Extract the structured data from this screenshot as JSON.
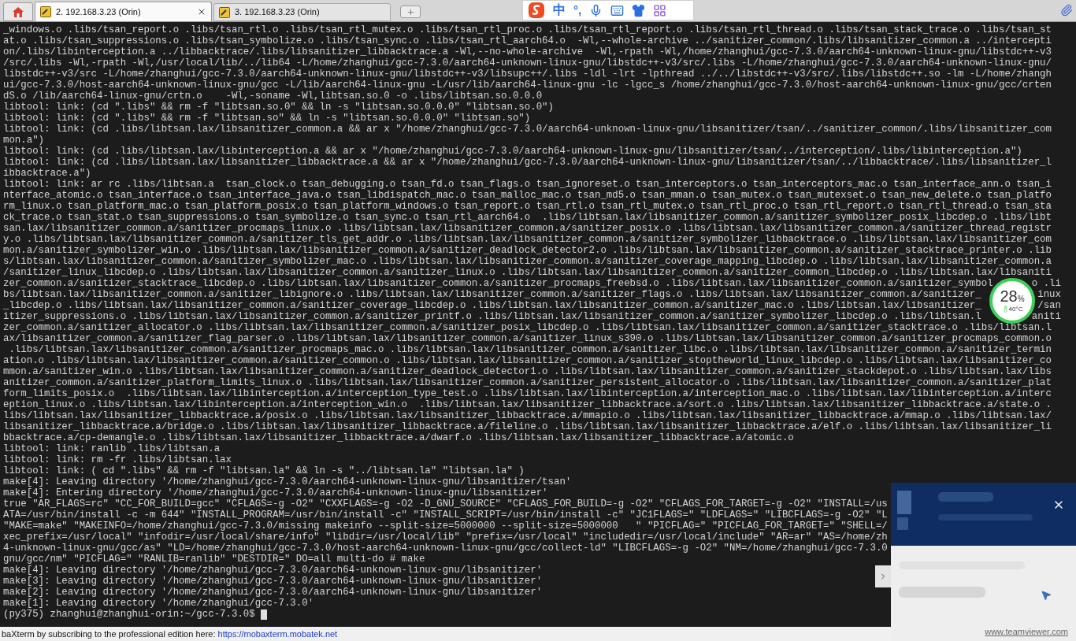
{
  "tabs": [
    {
      "label": "2. 192.168.3.23 (Orin)",
      "selected": true
    },
    {
      "label": "3. 192.168.3.23 (Orin)",
      "selected": false
    }
  ],
  "ime_toolbar": {
    "language": "中",
    "punctuation": "°,"
  },
  "terminal": {
    "lines": [
      "_windows.o .libs/tsan_report.o .libs/tsan_rtl.o .libs/tsan_rtl_mutex.o .libs/tsan_rtl_proc.o .libs/tsan_rtl_report.o .libs/tsan_rtl_thread.o .libs/tsan_stack_trace.o .libs/tsan_st",
      "at.o .libs/tsan_suppressions.o .libs/tsan_symbolize.o .libs/tsan_sync.o .libs/tsan_rtl_aarch64.o  -Wl,--whole-archive ../sanitizer_common/.libs/libsanitizer_common.a ../intercepti",
      "on/.libs/libinterception.a ../libbacktrace/.libs/libsanitizer_libbacktrace.a -Wl,--no-whole-archive  -Wl,-rpath -Wl,/home/zhanghui/gcc-7.3.0/aarch64-unknown-linux-gnu/libstdc++-v3",
      "/src/.libs -Wl,-rpath -Wl,/usr/local/lib/../lib64 -L/home/zhanghui/gcc-7.3.0/aarch64-unknown-linux-gnu/libstdc++-v3/src/.libs -L/home/zhanghui/gcc-7.3.0/aarch64-unknown-linux-gnu/",
      "libstdc++-v3/src -L/home/zhanghui/gcc-7.3.0/aarch64-unknown-linux-gnu/libstdc++-v3/libsupc++/.libs -ldl -lrt -lpthread ../../libstdc++-v3/src/.libs/libstdc++.so -lm -L/home/zhangh",
      "ui/gcc-7.3.0/host-aarch64-unknown-linux-gnu/gcc -L/lib/aarch64-linux-gnu -L/usr/lib/aarch64-linux-gnu -lc -lgcc_s /home/zhanghui/gcc-7.3.0/host-aarch64-unknown-linux-gnu/gcc/crten",
      "dS.o /lib/aarch64-linux-gnu/crtn.o    -Wl,-soname -Wl,libtsan.so.0 -o .libs/libtsan.so.0.0.0",
      "libtool: link: (cd \".libs\" && rm -f \"libtsan.so.0\" && ln -s \"libtsan.so.0.0.0\" \"libtsan.so.0\")",
      "libtool: link: (cd \".libs\" && rm -f \"libtsan.so\" && ln -s \"libtsan.so.0.0.0\" \"libtsan.so\")",
      "libtool: link: (cd .libs/libtsan.lax/libsanitizer_common.a && ar x \"/home/zhanghui/gcc-7.3.0/aarch64-unknown-linux-gnu/libsanitizer/tsan/../sanitizer_common/.libs/libsanitizer_com",
      "mon.a\")",
      "libtool: link: (cd .libs/libtsan.lax/libinterception.a && ar x \"/home/zhanghui/gcc-7.3.0/aarch64-unknown-linux-gnu/libsanitizer/tsan/../interception/.libs/libinterception.a\")",
      "libtool: link: (cd .libs/libtsan.lax/libsanitizer_libbacktrace.a && ar x \"/home/zhanghui/gcc-7.3.0/aarch64-unknown-linux-gnu/libsanitizer/tsan/../libbacktrace/.libs/libsanitizer_l",
      "ibbacktrace.a\")",
      "libtool: link: ar rc .libs/libtsan.a  tsan_clock.o tsan_debugging.o tsan_fd.o tsan_flags.o tsan_ignoreset.o tsan_interceptors.o tsan_interceptors_mac.o tsan_interface_ann.o tsan_i",
      "nterface_atomic.o tsan_interface.o tsan_interface_java.o tsan_libdispatch_mac.o tsan_malloc_mac.o tsan_md5.o tsan_mman.o tsan_mutex.o tsan_mutexset.o tsan_new_delete.o tsan_platfo",
      "rm_linux.o tsan_platform_mac.o tsan_platform_posix.o tsan_platform_windows.o tsan_report.o tsan_rtl.o tsan_rtl_mutex.o tsan_rtl_proc.o tsan_rtl_report.o tsan_rtl_thread.o tsan_sta",
      "ck_trace.o tsan_stat.o tsan_suppressions.o tsan_symbolize.o tsan_sync.o tsan_rtl_aarch64.o  .libs/libtsan.lax/libsanitizer_common.a/sanitizer_symbolizer_posix_libcdep.o .libs/libt",
      "san.lax/libsanitizer_common.a/sanitizer_procmaps_linux.o .libs/libtsan.lax/libsanitizer_common.a/sanitizer_posix.o .libs/libtsan.lax/libsanitizer_common.a/sanitizer_thread_registr",
      "y.o .libs/libtsan.lax/libsanitizer_common.a/sanitizer_tls_get_addr.o .libs/libtsan.lax/libsanitizer_common.a/sanitizer_symbolizer_libbacktrace.o .libs/libtsan.lax/libsanitizer_com",
      "mon.a/sanitizer_symbolizer_win.o .libs/libtsan.lax/libsanitizer_common.a/sanitizer_deadlock_detector2.o .libs/libtsan.lax/libsanitizer_common.a/sanitizer_stacktrace_printer.o .lib",
      "s/libtsan.lax/libsanitizer_common.a/sanitizer_symbolizer_mac.o .libs/libtsan.lax/libsanitizer_common.a/sanitizer_coverage_mapping_libcdep.o .libs/libtsan.lax/libsanitizer_common.a",
      "/sanitizer_linux_libcdep.o .libs/libtsan.lax/libsanitizer_common.a/sanitizer_linux.o .libs/libtsan.lax/libsanitizer_common.a/sanitizer_common_libcdep.o .libs/libtsan.lax/libsaniti",
      {
        "text": "zer_common.a/sanitizer_stacktrace_libcdep.o .libs/libtsan.lax/libsanitizer_common.a/sanitizer_procmaps_freebsd.o .libs/libtsan.lax/libsanitizer_common.a/sanitizer_symbol",
        "tail": "o .li"
      },
      {
        "text": "bs/libtsan.lax/libsanitizer_common.a/sanitizer_libignore.o .libs/libtsan.lax/libsanitizer_common.a/sanitizer_flags.o .libs/libtsan.lax/libsanitizer_common.a/sanitizer_",
        "tail": "inux"
      },
      {
        "text": "_libcdep.o .libs/libtsan.lax/libsanitizer_common.a/sanitizer_coverage_libcdep.o .libs/libtsan.lax/libsanitizer_common.a/sanitizer_mac.o .libs/libtsan.lax/libsanitizer_",
        "tail": "/san"
      },
      {
        "text": "itizer_suppressions.o .libs/libtsan.lax/libsanitizer_common.a/sanitizer_printf.o .libs/libtsan.lax/libsanitizer_common.a/sanitizer_symbolizer_libcdep.o .libs/libtsan.l",
        "tail": "aniti"
      },
      "zer_common.a/sanitizer_allocator.o .libs/libtsan.lax/libsanitizer_common.a/sanitizer_posix_libcdep.o .libs/libtsan.lax/libsanitizer_common.a/sanitizer_stacktrace.o .libs/libtsan.l",
      "ax/libsanitizer_common.a/sanitizer_flag_parser.o .libs/libtsan.lax/libsanitizer_common.a/sanitizer_linux_s390.o .libs/libtsan.lax/libsanitizer_common.a/sanitizer_procmaps_common.o",
      " .libs/libtsan.lax/libsanitizer_common.a/sanitizer_procmaps_mac.o .libs/libtsan.lax/libsanitizer_common.a/sanitizer_libc.o .libs/libtsan.lax/libsanitizer_common.a/sanitizer_termin",
      "ation.o .libs/libtsan.lax/libsanitizer_common.a/sanitizer_common.o .libs/libtsan.lax/libsanitizer_common.a/sanitizer_stoptheworld_linux_libcdep.o .libs/libtsan.lax/libsanitizer_co",
      "mmon.a/sanitizer_win.o .libs/libtsan.lax/libsanitizer_common.a/sanitizer_deadlock_detector1.o .libs/libtsan.lax/libsanitizer_common.a/sanitizer_stackdepot.o .libs/libtsan.lax/libs",
      "anitizer_common.a/sanitizer_platform_limits_linux.o .libs/libtsan.lax/libsanitizer_common.a/sanitizer_persistent_allocator.o .libs/libtsan.lax/libsanitizer_common.a/sanitizer_plat",
      "form_limits_posix.o  .libs/libtsan.lax/libinterception.a/interception_type_test.o .libs/libtsan.lax/libinterception.a/interception_mac.o .libs/libtsan.lax/libinterception.a/interc",
      "eption_linux.o .libs/libtsan.lax/libinterception.a/interception_win.o  .libs/libtsan.lax/libsanitizer_libbacktrace.a/sort.o .libs/libtsan.lax/libsanitizer_libbacktrace.a/state.o .",
      "libs/libtsan.lax/libsanitizer_libbacktrace.a/posix.o .libs/libtsan.lax/libsanitizer_libbacktrace.a/mmapio.o .libs/libtsan.lax/libsanitizer_libbacktrace.a/mmap.o .libs/libtsan.lax/",
      "libsanitizer_libbacktrace.a/bridge.o .libs/libtsan.lax/libsanitizer_libbacktrace.a/fileline.o .libs/libtsan.lax/libsanitizer_libbacktrace.a/elf.o .libs/libtsan.lax/libsanitizer_li",
      "bbacktrace.a/cp-demangle.o .libs/libtsan.lax/libsanitizer_libbacktrace.a/dwarf.o .libs/libtsan.lax/libsanitizer_libbacktrace.a/atomic.o",
      "libtool: link: ranlib .libs/libtsan.a",
      "libtool: link: rm -fr .libs/libtsan.lax",
      "libtool: link: ( cd \".libs\" && rm -f \"libtsan.la\" && ln -s \"../libtsan.la\" \"libtsan.la\" )",
      "make[4]: Leaving directory '/home/zhanghui/gcc-7.3.0/aarch64-unknown-linux-gnu/libsanitizer/tsan'",
      "make[4]: Entering directory '/home/zhanghui/gcc-7.3.0/aarch64-unknown-linux-gnu/libsanitizer'",
      "true \"AR_FLAGS=rc\" \"CC_FOR_BUILD=gcc\" \"CFLAGS=-g -O2\" \"CXXFLAGS=-g -O2 -D_GNU_SOURCE\" \"CFLAGS_FOR_BUILD=-g -O2\" \"CFLAGS_FOR_TARGET=-g -O2\" \"INSTALL=/us",
      "ATA=/usr/bin/install -c -m 644\" \"INSTALL_PROGRAM=/usr/bin/install -c\" \"INSTALL_SCRIPT=/usr/bin/install -c\" \"JC1FLAGS=\" \"LDFLAGS=\" \"LIBCFLAGS=-g -O2\" \"L",
      "\"MAKE=make\" \"MAKEINFO=/home/zhanghui/gcc-7.3.0/missing makeinfo --split-size=5000000 --split-size=5000000   \" \"PICFLAG=\" \"PICFLAG_FOR_TARGET=\" \"SHELL=/",
      "xec_prefix=/usr/local\" \"infodir=/usr/local/share/info\" \"libdir=/usr/local/lib\" \"prefix=/usr/local\" \"includedir=/usr/local/include\" \"AR=ar\" \"AS=/home/zh",
      "4-unknown-linux-gnu/gcc/as\" \"LD=/home/zhanghui/gcc-7.3.0/host-aarch64-unknown-linux-gnu/gcc/collect-ld\" \"LIBCFLAGS=-g -O2\" \"NM=/home/zhanghui/gcc-7.3.0",
      "gnu/gcc/nm\" \"PICFLAG=\" \"RANLIB=ranlib\" \"DESTDIR=\" DO=all multi-do # make",
      "make[4]: Leaving directory '/home/zhanghui/gcc-7.3.0/aarch64-unknown-linux-gnu/libsanitizer'",
      "make[3]: Leaving directory '/home/zhanghui/gcc-7.3.0/aarch64-unknown-linux-gnu/libsanitizer'",
      "make[2]: Leaving directory '/home/zhanghui/gcc-7.3.0/aarch64-unknown-linux-gnu/libsanitizer'",
      "make[1]: Leaving directory '/home/zhanghui/gcc-7.3.0'"
    ],
    "prompt": "(py375) zhanghui@zhanghui-orin:~/gcc-7.3.0$ "
  },
  "cpu_widget": {
    "usage": "28",
    "unit": "%",
    "temperature": "40°C"
  },
  "teamviewer_popup": {
    "link": "www.teamviewer.com"
  },
  "status_bar": {
    "text": "baXterm by subscribing to the professional edition here: ",
    "link": "https://mobaxterm.mobatek.net"
  }
}
